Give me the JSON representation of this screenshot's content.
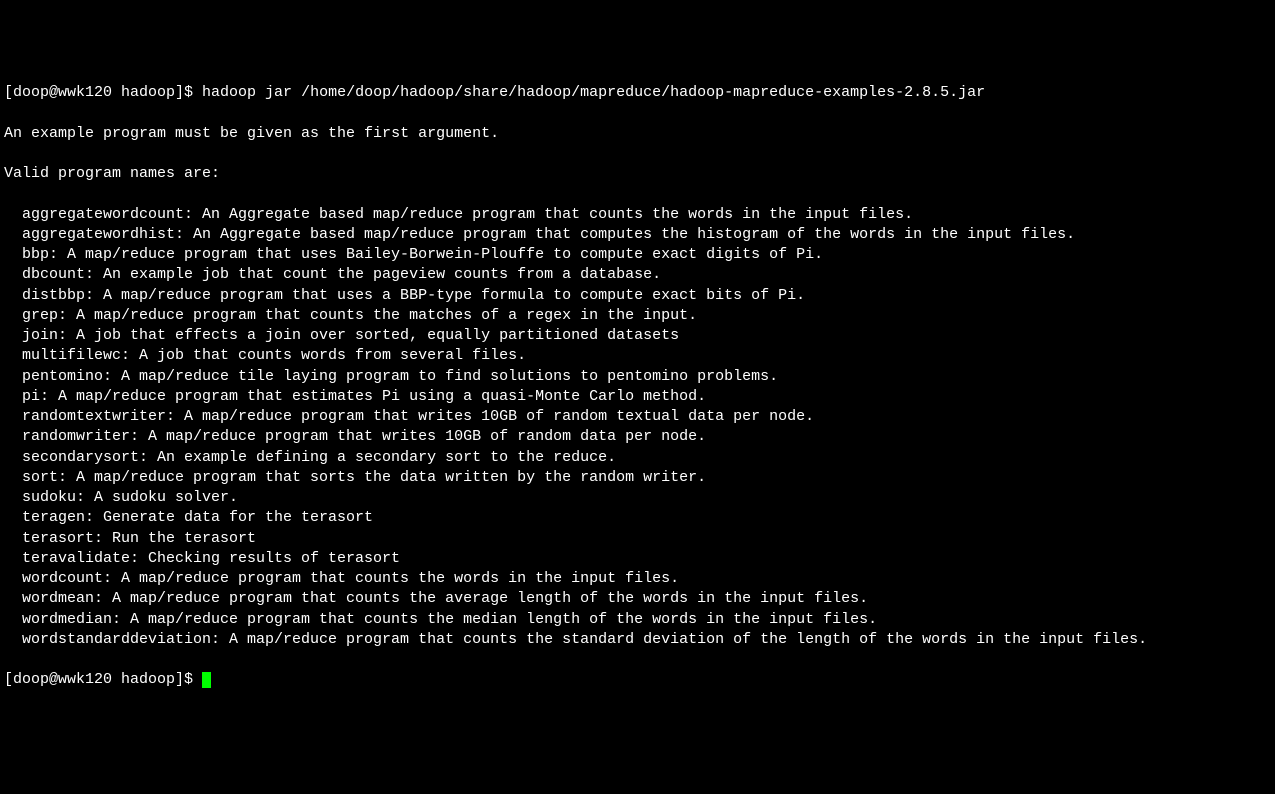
{
  "prompt1_prefix": "[doop@wwk120 hadoop]$ ",
  "command": "hadoop jar /home/doop/hadoop/share/hadoop/mapreduce/hadoop-mapreduce-examples-2.8.5.jar",
  "error_msg": "An example program must be given as the first argument.",
  "valid_header": "Valid program names are:",
  "programs": [
    {
      "name": "aggregatewordcount",
      "desc": "An Aggregate based map/reduce program that counts the words in the input files."
    },
    {
      "name": "aggregatewordhist",
      "desc": "An Aggregate based map/reduce program that computes the histogram of the words in the input files."
    },
    {
      "name": "bbp",
      "desc": "A map/reduce program that uses Bailey-Borwein-Plouffe to compute exact digits of Pi."
    },
    {
      "name": "dbcount",
      "desc": "An example job that count the pageview counts from a database."
    },
    {
      "name": "distbbp",
      "desc": "A map/reduce program that uses a BBP-type formula to compute exact bits of Pi."
    },
    {
      "name": "grep",
      "desc": "A map/reduce program that counts the matches of a regex in the input."
    },
    {
      "name": "join",
      "desc": "A job that effects a join over sorted, equally partitioned datasets"
    },
    {
      "name": "multifilewc",
      "desc": "A job that counts words from several files."
    },
    {
      "name": "pentomino",
      "desc": "A map/reduce tile laying program to find solutions to pentomino problems."
    },
    {
      "name": "pi",
      "desc": "A map/reduce program that estimates Pi using a quasi-Monte Carlo method."
    },
    {
      "name": "randomtextwriter",
      "desc": "A map/reduce program that writes 10GB of random textual data per node."
    },
    {
      "name": "randomwriter",
      "desc": "A map/reduce program that writes 10GB of random data per node."
    },
    {
      "name": "secondarysort",
      "desc": "An example defining a secondary sort to the reduce."
    },
    {
      "name": "sort",
      "desc": "A map/reduce program that sorts the data written by the random writer."
    },
    {
      "name": "sudoku",
      "desc": "A sudoku solver."
    },
    {
      "name": "teragen",
      "desc": "Generate data for the terasort"
    },
    {
      "name": "terasort",
      "desc": "Run the terasort"
    },
    {
      "name": "teravalidate",
      "desc": "Checking results of terasort"
    },
    {
      "name": "wordcount",
      "desc": "A map/reduce program that counts the words in the input files."
    },
    {
      "name": "wordmean",
      "desc": "A map/reduce program that counts the average length of the words in the input files."
    },
    {
      "name": "wordmedian",
      "desc": "A map/reduce program that counts the median length of the words in the input files."
    },
    {
      "name": "wordstandarddeviation",
      "desc": "A map/reduce program that counts the standard deviation of the length of the words in the input files."
    }
  ],
  "prompt2_prefix": "[doop@wwk120 hadoop]$ "
}
